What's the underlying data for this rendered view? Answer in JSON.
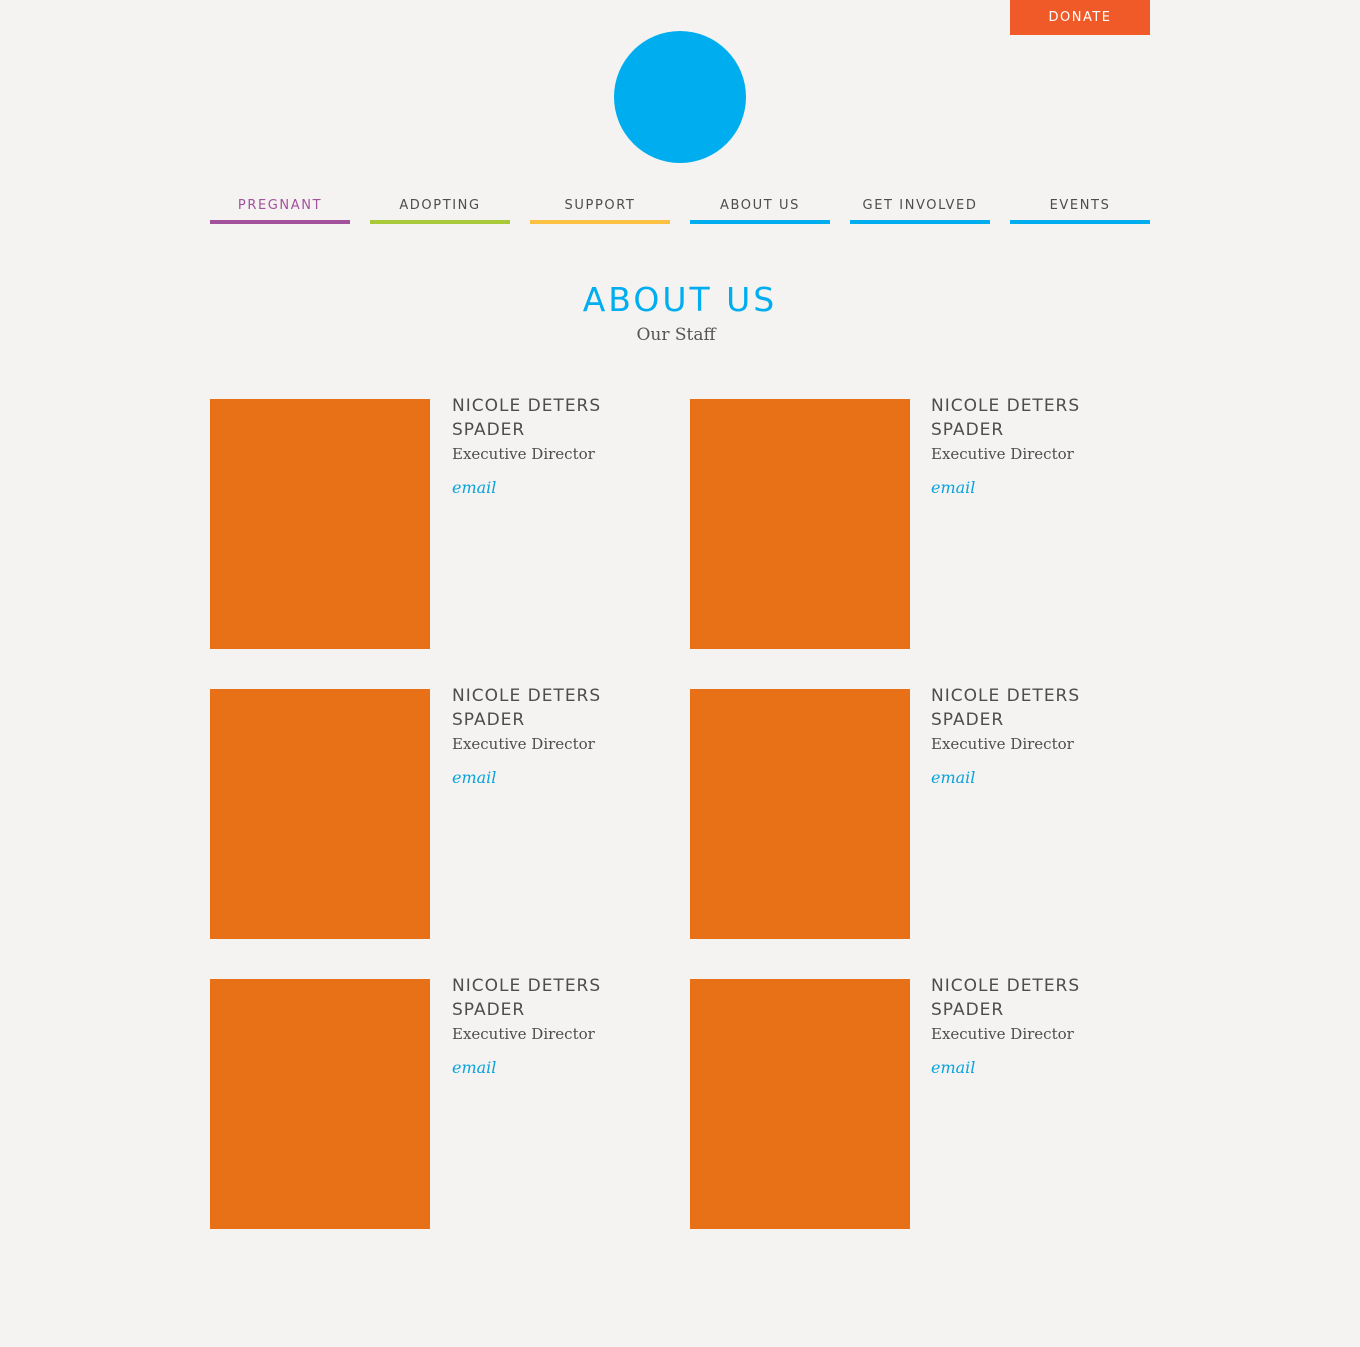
{
  "header": {
    "donate_label": "DONATE",
    "logo": "circle-logo",
    "accent_color": "#00aeef",
    "donate_color": "#f05a28"
  },
  "nav": {
    "items": [
      {
        "label": "PREGNANT",
        "underline_color": "#a4519d",
        "text_color": "#a4519d"
      },
      {
        "label": "ADOPTING",
        "underline_color": "#a7c93a",
        "text_color": "#4d4d4d"
      },
      {
        "label": "SUPPORT",
        "underline_color": "#fcc142",
        "text_color": "#4d4d4d"
      },
      {
        "label": "ABOUT US",
        "underline_color": "#00aeef",
        "text_color": "#4d4d4d"
      },
      {
        "label": "GET INVOLVED",
        "underline_color": "#00aeef",
        "text_color": "#4d4d4d"
      },
      {
        "label": "EVENTS",
        "underline_color": "#00aeef",
        "text_color": "#4d4d4d"
      }
    ]
  },
  "page": {
    "title": "ABOUT US",
    "subtitle": "Our Staff"
  },
  "staff": [
    {
      "name": "NICOLE DETERS SPADER",
      "role": "Executive Director",
      "email_label": "email",
      "photo_color": "#e87017"
    },
    {
      "name": "NICOLE DETERS SPADER",
      "role": "Executive Director",
      "email_label": "email",
      "photo_color": "#e87017"
    },
    {
      "name": "NICOLE DETERS SPADER",
      "role": "Executive Director",
      "email_label": "email",
      "photo_color": "#e87017"
    },
    {
      "name": "NICOLE DETERS SPADER",
      "role": "Executive Director",
      "email_label": "email",
      "photo_color": "#e87017"
    },
    {
      "name": "NICOLE DETERS SPADER",
      "role": "Executive Director",
      "email_label": "email",
      "photo_color": "#e87017"
    },
    {
      "name": "NICOLE DETERS SPADER",
      "role": "Executive Director",
      "email_label": "email",
      "photo_color": "#e87017"
    }
  ]
}
